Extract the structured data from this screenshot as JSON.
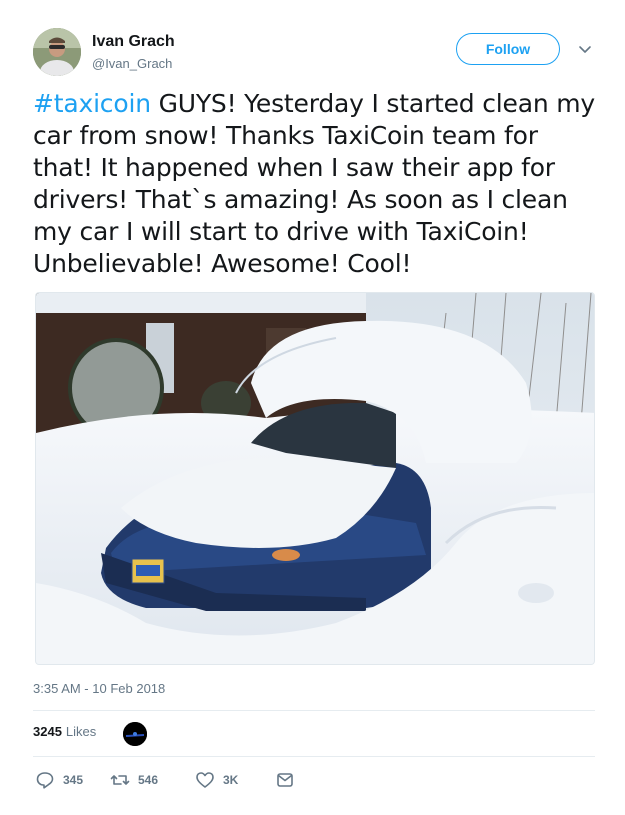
{
  "author": {
    "display_name": "Ivan Grach",
    "handle": "@Ivan_Grach",
    "avatar_icon": "user-avatar"
  },
  "follow_button": {
    "label": "Follow"
  },
  "caret_icon": "chevron-down-icon",
  "tweet": {
    "hashtag": "#taxicoin",
    "text": " GUYS! Yesterday I started clean my car from snow! Thanks TaxiCoin team for that! It happened when I saw their app for drivers! That`s amazing! As soon as I clean my car I will start to drive with TaxiCoin! Unbelievable! Awesome! Cool!"
  },
  "media": {
    "plate_text": ""
  },
  "timestamp": "3:35 AM - 10 Feb 2018",
  "stats": {
    "likes_count": "3245",
    "likes_label": "Likes"
  },
  "actions": {
    "reply_count": "345",
    "retweet_count": "546",
    "like_count": "3K"
  },
  "colors": {
    "accent": "#1da1f2",
    "secondary_text": "#657786",
    "divider": "#e6ecf0"
  }
}
